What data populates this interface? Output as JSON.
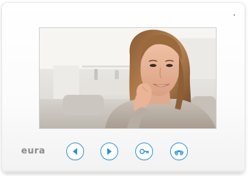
{
  "brand": {
    "logo_text": "eura"
  },
  "screen": {
    "content": "video-feed"
  },
  "controls": [
    {
      "icon": "previous-arrow-icon"
    },
    {
      "icon": "next-arrow-icon"
    },
    {
      "icon": "key-unlock-icon"
    },
    {
      "icon": "handset-icon"
    }
  ],
  "colors": {
    "accent": "#2a8fd8",
    "device_body": "#ffffff",
    "logo": "#8a8a8a"
  }
}
